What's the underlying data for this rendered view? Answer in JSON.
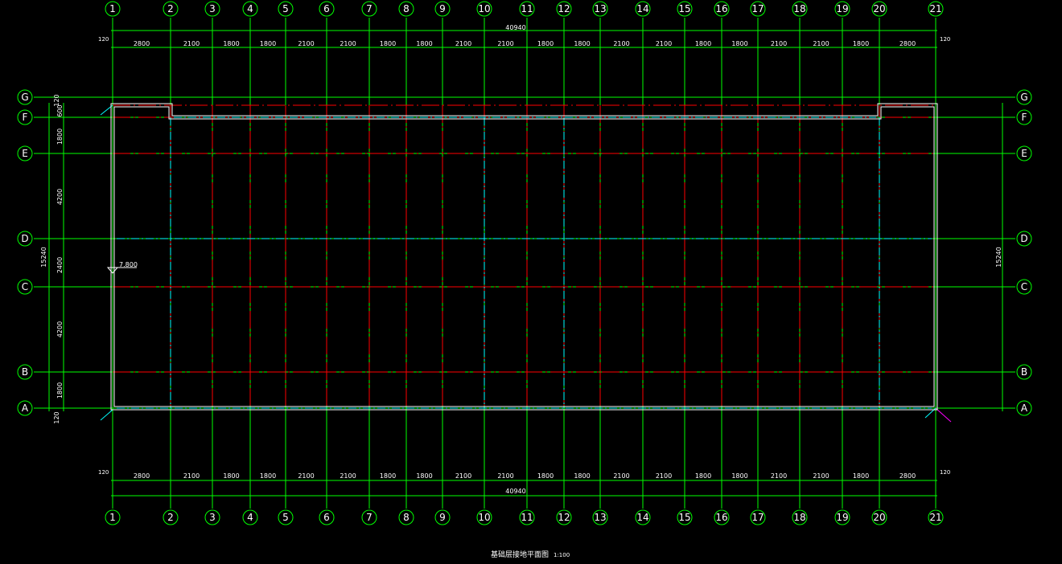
{
  "grid": {
    "columns": [
      "1",
      "2",
      "3",
      "4",
      "5",
      "6",
      "7",
      "8",
      "9",
      "10",
      "11",
      "12",
      "13",
      "14",
      "15",
      "16",
      "17",
      "18",
      "19",
      "20",
      "21"
    ],
    "rows": [
      "G",
      "F",
      "E",
      "D",
      "C",
      "B",
      "A"
    ]
  },
  "dimensions": {
    "top_spacings": [
      "2800",
      "2100",
      "1800",
      "1800",
      "2100",
      "2100",
      "1800",
      "1800",
      "2100",
      "2100",
      "1800",
      "1800",
      "2100",
      "2100",
      "1800",
      "1800",
      "2100",
      "2100",
      "1800",
      "2800"
    ],
    "bottom_spacings": [
      "2800",
      "2100",
      "1800",
      "1800",
      "2100",
      "2100",
      "1800",
      "1800",
      "2100",
      "2100",
      "1800",
      "1800",
      "2100",
      "2100",
      "1800",
      "1800",
      "2100",
      "2100",
      "1800",
      "2800"
    ],
    "overall_length": "40940",
    "edge_offset": "120",
    "left_spacings": [
      "120",
      "600",
      "1800",
      "4200",
      "2400",
      "4200",
      "1800",
      "120"
    ],
    "overall_width": "15240"
  },
  "elevation_mark": "7.800",
  "drawing_title": "基础层接地平面图",
  "drawing_scale": "1:100",
  "colors": {
    "grid_line": "#00ff00",
    "beam_line": "#ff0000",
    "ground_line": "#00ffff",
    "wall_line": "#ffffff",
    "background": "#000000"
  }
}
